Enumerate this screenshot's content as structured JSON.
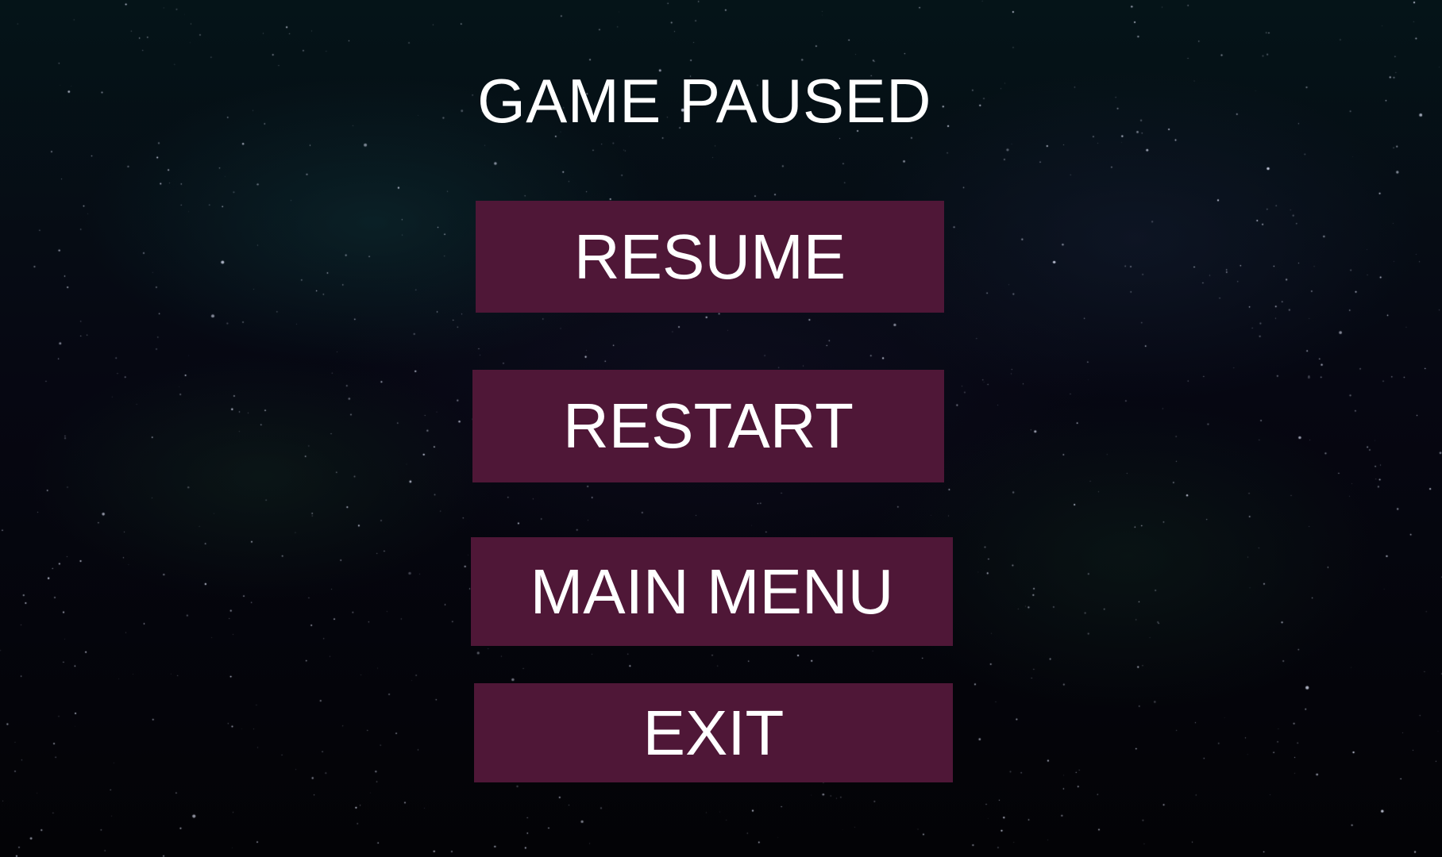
{
  "pause_menu": {
    "title": "GAME PAUSED",
    "buttons": [
      {
        "id": "resume",
        "label": "RESUME"
      },
      {
        "id": "restart",
        "label": "RESTART"
      },
      {
        "id": "main_menu",
        "label": "MAIN MENU"
      },
      {
        "id": "exit",
        "label": "EXIT"
      }
    ]
  },
  "colors": {
    "button_bg": "#4f1737",
    "text": "#ffffff",
    "background": "#050810"
  }
}
